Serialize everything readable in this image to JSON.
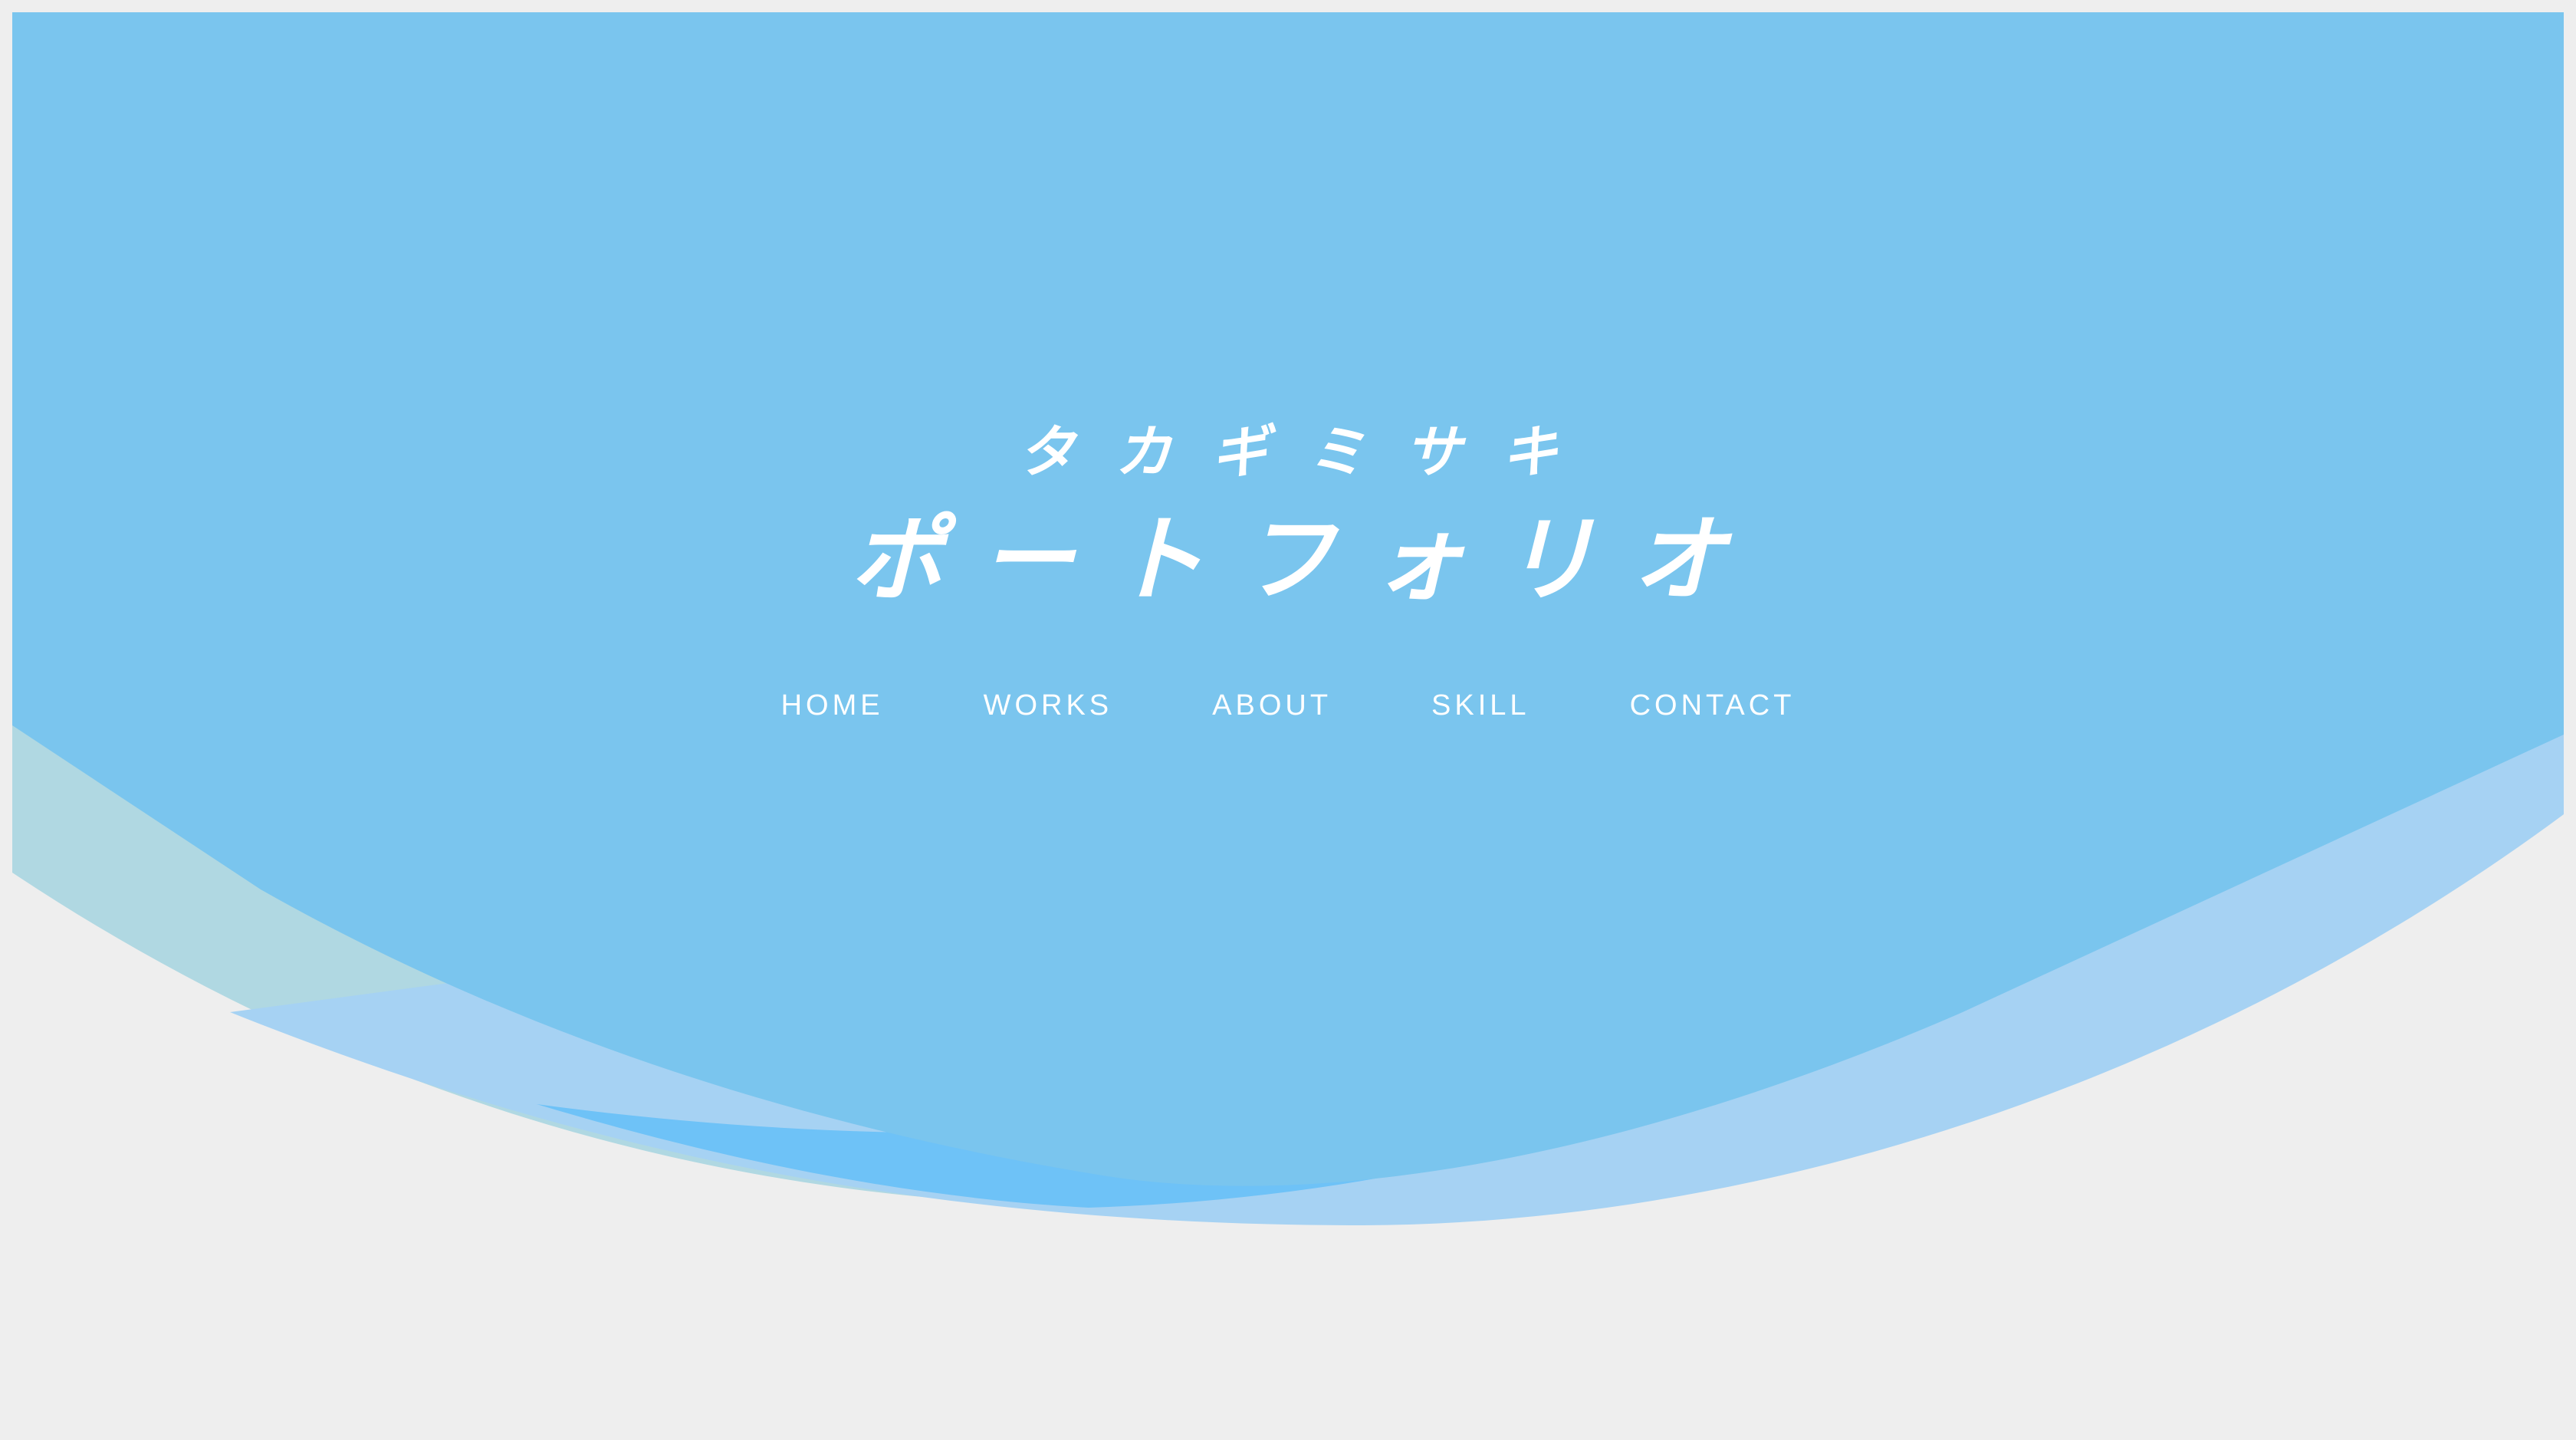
{
  "header": {
    "subtitle": "タカギミサキ",
    "title": "ポートフォリオ"
  },
  "nav": {
    "items": [
      {
        "label": "HOME"
      },
      {
        "label": "WORKS"
      },
      {
        "label": "ABOUT"
      },
      {
        "label": "SKILL"
      },
      {
        "label": "CONTACT"
      }
    ]
  },
  "colors": {
    "page_background": "#eeeeee",
    "hero_blue": "#7ac5ee",
    "wave_teal": "#b0d8e2",
    "wave_light_blue": "#a6d2f3",
    "wave_mid_blue": "#6ec2f7",
    "text": "#ffffff"
  }
}
